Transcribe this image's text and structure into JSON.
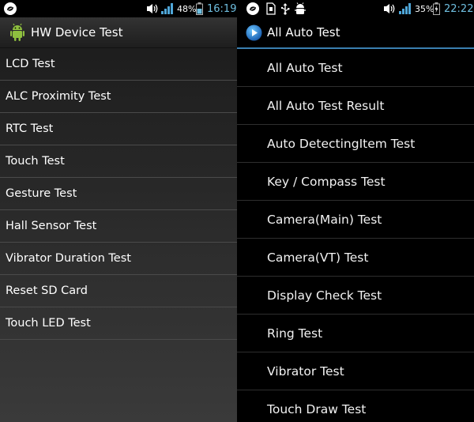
{
  "left": {
    "status": {
      "battery_percent": "48%",
      "time": "16:19",
      "signal_level": 1.0
    },
    "title": "HW Device Test",
    "items": [
      "LCD Test",
      "ALC Proximity Test",
      "RTC Test",
      "Touch Test",
      "Gesture Test",
      "Hall Sensor Test",
      "Vibrator Duration Test",
      "Reset SD Card",
      "Touch LED Test"
    ]
  },
  "right": {
    "status": {
      "battery_percent": "35%",
      "time": "22:22",
      "signal_level": 1.0
    },
    "title": "All Auto Test",
    "items": [
      "All Auto Test",
      "All Auto Test Result",
      "Auto DetectingItem Test",
      "Key / Compass Test",
      "Camera(Main) Test",
      "Camera(VT) Test",
      "Display Check Test",
      "Ring Test",
      "Vibrator Test",
      "Touch Draw Test"
    ]
  },
  "icons": {
    "status_app": "sync-swirl-icon",
    "volume": "speaker-volume-icon",
    "battery_status": "battery-icon",
    "sd_card": "sd-card-icon",
    "usb": "usb-icon",
    "debug": "android-debug-icon",
    "left_app": "android-robot-icon",
    "right_app": "play-circle-icon"
  },
  "colors": {
    "accent_blue": "#3a7fb0",
    "signal_blue": "#4fa6d8",
    "battery_time_blue": "#6fbfe0",
    "android_green": "#8ebf3f"
  }
}
